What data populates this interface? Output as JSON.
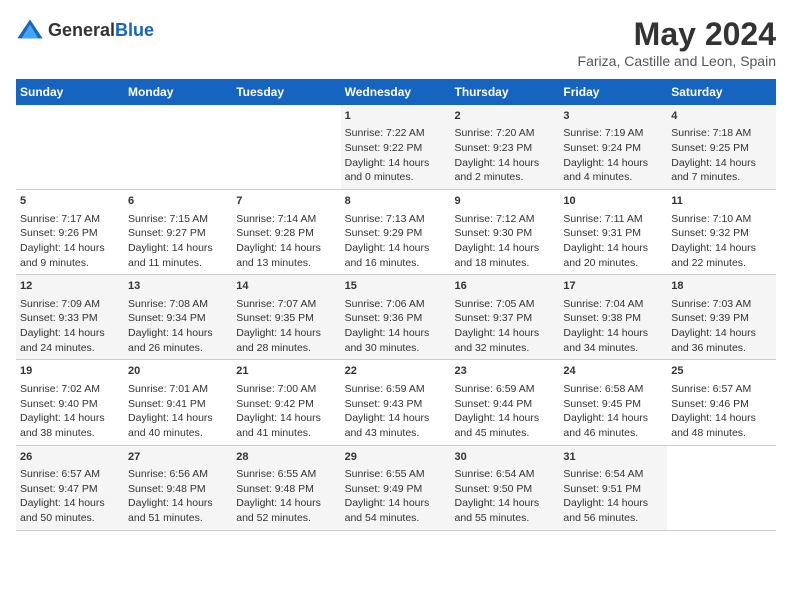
{
  "header": {
    "logo_general": "General",
    "logo_blue": "Blue",
    "title": "May 2024",
    "subtitle": "Fariza, Castille and Leon, Spain"
  },
  "columns": [
    "Sunday",
    "Monday",
    "Tuesday",
    "Wednesday",
    "Thursday",
    "Friday",
    "Saturday"
  ],
  "weeks": [
    [
      {
        "day": "",
        "info": ""
      },
      {
        "day": "",
        "info": ""
      },
      {
        "day": "",
        "info": ""
      },
      {
        "day": "1",
        "info": "Sunrise: 7:22 AM\nSunset: 9:22 PM\nDaylight: 14 hours\nand 0 minutes."
      },
      {
        "day": "2",
        "info": "Sunrise: 7:20 AM\nSunset: 9:23 PM\nDaylight: 14 hours\nand 2 minutes."
      },
      {
        "day": "3",
        "info": "Sunrise: 7:19 AM\nSunset: 9:24 PM\nDaylight: 14 hours\nand 4 minutes."
      },
      {
        "day": "4",
        "info": "Sunrise: 7:18 AM\nSunset: 9:25 PM\nDaylight: 14 hours\nand 7 minutes."
      }
    ],
    [
      {
        "day": "5",
        "info": "Sunrise: 7:17 AM\nSunset: 9:26 PM\nDaylight: 14 hours\nand 9 minutes."
      },
      {
        "day": "6",
        "info": "Sunrise: 7:15 AM\nSunset: 9:27 PM\nDaylight: 14 hours\nand 11 minutes."
      },
      {
        "day": "7",
        "info": "Sunrise: 7:14 AM\nSunset: 9:28 PM\nDaylight: 14 hours\nand 13 minutes."
      },
      {
        "day": "8",
        "info": "Sunrise: 7:13 AM\nSunset: 9:29 PM\nDaylight: 14 hours\nand 16 minutes."
      },
      {
        "day": "9",
        "info": "Sunrise: 7:12 AM\nSunset: 9:30 PM\nDaylight: 14 hours\nand 18 minutes."
      },
      {
        "day": "10",
        "info": "Sunrise: 7:11 AM\nSunset: 9:31 PM\nDaylight: 14 hours\nand 20 minutes."
      },
      {
        "day": "11",
        "info": "Sunrise: 7:10 AM\nSunset: 9:32 PM\nDaylight: 14 hours\nand 22 minutes."
      }
    ],
    [
      {
        "day": "12",
        "info": "Sunrise: 7:09 AM\nSunset: 9:33 PM\nDaylight: 14 hours\nand 24 minutes."
      },
      {
        "day": "13",
        "info": "Sunrise: 7:08 AM\nSunset: 9:34 PM\nDaylight: 14 hours\nand 26 minutes."
      },
      {
        "day": "14",
        "info": "Sunrise: 7:07 AM\nSunset: 9:35 PM\nDaylight: 14 hours\nand 28 minutes."
      },
      {
        "day": "15",
        "info": "Sunrise: 7:06 AM\nSunset: 9:36 PM\nDaylight: 14 hours\nand 30 minutes."
      },
      {
        "day": "16",
        "info": "Sunrise: 7:05 AM\nSunset: 9:37 PM\nDaylight: 14 hours\nand 32 minutes."
      },
      {
        "day": "17",
        "info": "Sunrise: 7:04 AM\nSunset: 9:38 PM\nDaylight: 14 hours\nand 34 minutes."
      },
      {
        "day": "18",
        "info": "Sunrise: 7:03 AM\nSunset: 9:39 PM\nDaylight: 14 hours\nand 36 minutes."
      }
    ],
    [
      {
        "day": "19",
        "info": "Sunrise: 7:02 AM\nSunset: 9:40 PM\nDaylight: 14 hours\nand 38 minutes."
      },
      {
        "day": "20",
        "info": "Sunrise: 7:01 AM\nSunset: 9:41 PM\nDaylight: 14 hours\nand 40 minutes."
      },
      {
        "day": "21",
        "info": "Sunrise: 7:00 AM\nSunset: 9:42 PM\nDaylight: 14 hours\nand 41 minutes."
      },
      {
        "day": "22",
        "info": "Sunrise: 6:59 AM\nSunset: 9:43 PM\nDaylight: 14 hours\nand 43 minutes."
      },
      {
        "day": "23",
        "info": "Sunrise: 6:59 AM\nSunset: 9:44 PM\nDaylight: 14 hours\nand 45 minutes."
      },
      {
        "day": "24",
        "info": "Sunrise: 6:58 AM\nSunset: 9:45 PM\nDaylight: 14 hours\nand 46 minutes."
      },
      {
        "day": "25",
        "info": "Sunrise: 6:57 AM\nSunset: 9:46 PM\nDaylight: 14 hours\nand 48 minutes."
      }
    ],
    [
      {
        "day": "26",
        "info": "Sunrise: 6:57 AM\nSunset: 9:47 PM\nDaylight: 14 hours\nand 50 minutes."
      },
      {
        "day": "27",
        "info": "Sunrise: 6:56 AM\nSunset: 9:48 PM\nDaylight: 14 hours\nand 51 minutes."
      },
      {
        "day": "28",
        "info": "Sunrise: 6:55 AM\nSunset: 9:48 PM\nDaylight: 14 hours\nand 52 minutes."
      },
      {
        "day": "29",
        "info": "Sunrise: 6:55 AM\nSunset: 9:49 PM\nDaylight: 14 hours\nand 54 minutes."
      },
      {
        "day": "30",
        "info": "Sunrise: 6:54 AM\nSunset: 9:50 PM\nDaylight: 14 hours\nand 55 minutes."
      },
      {
        "day": "31",
        "info": "Sunrise: 6:54 AM\nSunset: 9:51 PM\nDaylight: 14 hours\nand 56 minutes."
      },
      {
        "day": "",
        "info": ""
      }
    ]
  ]
}
